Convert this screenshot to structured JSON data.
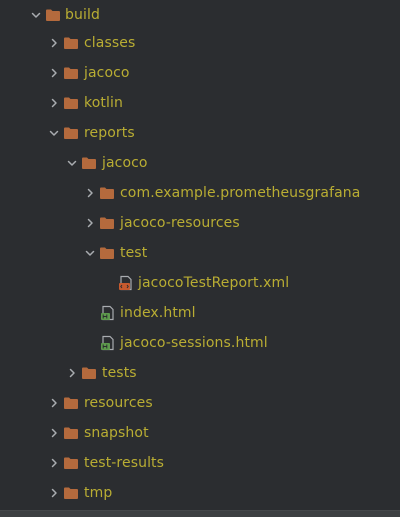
{
  "tree": {
    "nodes": [
      {
        "label": "build",
        "kind": "folder",
        "expanded": true
      },
      {
        "label": "classes",
        "kind": "folder",
        "expanded": false
      },
      {
        "label": "jacoco",
        "kind": "folder",
        "expanded": false
      },
      {
        "label": "kotlin",
        "kind": "folder",
        "expanded": false
      },
      {
        "label": "reports",
        "kind": "folder",
        "expanded": true
      },
      {
        "label": "jacoco",
        "kind": "folder",
        "expanded": true
      },
      {
        "label": "com.example.prometheusgrafana",
        "kind": "folder",
        "expanded": false
      },
      {
        "label": "jacoco-resources",
        "kind": "folder",
        "expanded": false
      },
      {
        "label": "test",
        "kind": "folder",
        "expanded": true
      },
      {
        "label": "jacocoTestReport.xml",
        "kind": "xml-file"
      },
      {
        "label": "index.html",
        "kind": "html-file"
      },
      {
        "label": "jacoco-sessions.html",
        "kind": "html-file"
      },
      {
        "label": "tests",
        "kind": "folder",
        "expanded": false
      },
      {
        "label": "resources",
        "kind": "folder",
        "expanded": false
      },
      {
        "label": "snapshot",
        "kind": "folder",
        "expanded": false
      },
      {
        "label": "test-results",
        "kind": "folder",
        "expanded": false
      },
      {
        "label": "tmp",
        "kind": "folder",
        "expanded": false
      }
    ]
  },
  "colors": {
    "background": "#2b2d30",
    "label": "#b9ad33",
    "folder": "#b46a3d",
    "chevron": "#a9acb0"
  },
  "icons": {
    "folder": "folder-icon",
    "xml": "xml-file-icon",
    "html": "html-file-icon",
    "collapsed": "chevron-right-icon",
    "expanded": "chevron-down-icon"
  }
}
